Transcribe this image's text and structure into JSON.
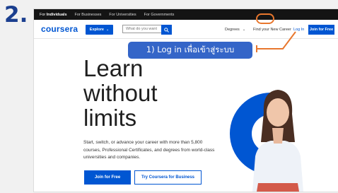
{
  "step": {
    "number": "2."
  },
  "topbar": {
    "links": [
      {
        "prefix": "For ",
        "bold": "Individuals"
      },
      {
        "label": "For Businesses"
      },
      {
        "label": "For Universities"
      },
      {
        "label": "For Governments"
      }
    ]
  },
  "navbar": {
    "logo": "coursera",
    "explore_label": "Explore",
    "search_placeholder": "What do you want",
    "degrees_label": "Degrees",
    "career_label": "Find your New Career",
    "login_label": "Log In",
    "join_label": "Join for Free"
  },
  "hero": {
    "title_lines": [
      "Learn",
      "without",
      "limits"
    ],
    "subtitle": "Start, switch, or advance your career with more than 5,800 courses, Professional Certificates, and degrees from world-class universities and companies.",
    "join_button": "Join for Free",
    "business_button": "Try Coursera for Business"
  },
  "annotation": {
    "text": "1) Log in เพื่อเข้าสู่ระบบ"
  },
  "colors": {
    "brand_blue": "#0056d2",
    "annotation_blue": "#3465c8",
    "annotation_orange": "#e8772e",
    "step_number": "#1b3f8f"
  }
}
